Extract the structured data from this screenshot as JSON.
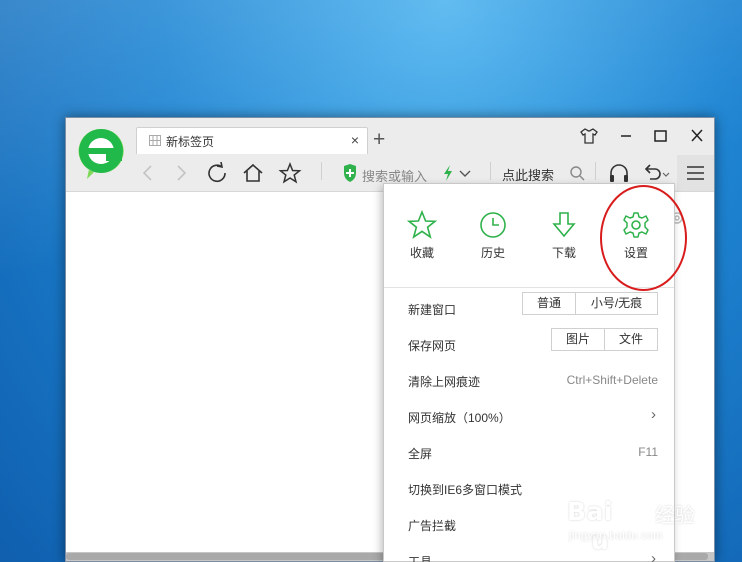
{
  "browser": {
    "tab_title": "新标签页",
    "tab_close": "×",
    "new_tab": "+",
    "address_placeholder": "搜索或输入",
    "search_label": "点此搜索"
  },
  "quick_actions": [
    {
      "label": "收藏",
      "icon": "star-icon"
    },
    {
      "label": "历史",
      "icon": "clock-icon"
    },
    {
      "label": "下载",
      "icon": "download-icon"
    },
    {
      "label": "设置",
      "icon": "gear-icon"
    }
  ],
  "menu": {
    "new_window": {
      "label": "新建窗口",
      "options": [
        "普通",
        "小号/无痕"
      ]
    },
    "save_page": {
      "label": "保存网页",
      "options": [
        "图片",
        "文件"
      ]
    },
    "clear_history": {
      "label": "清除上网痕迹",
      "shortcut": "Ctrl+Shift+Delete"
    },
    "zoom": {
      "label": "网页缩放（100%）",
      "arrow": "›"
    },
    "fullscreen": {
      "label": "全屏",
      "shortcut": "F11"
    },
    "ie6_mode": {
      "label": "切换到IE6多窗口模式"
    },
    "ad_block": {
      "label": "广告拦截"
    },
    "tools": {
      "label": "工具",
      "arrow": "›"
    }
  },
  "watermark": {
    "brand_latin": "Bai",
    "brand_latin_end": "u",
    "brand_cn": "经验",
    "url": "jingyan.baidu.com"
  },
  "colors": {
    "accent_green": "#2fb24b",
    "annotation_red": "#d81c1c"
  }
}
